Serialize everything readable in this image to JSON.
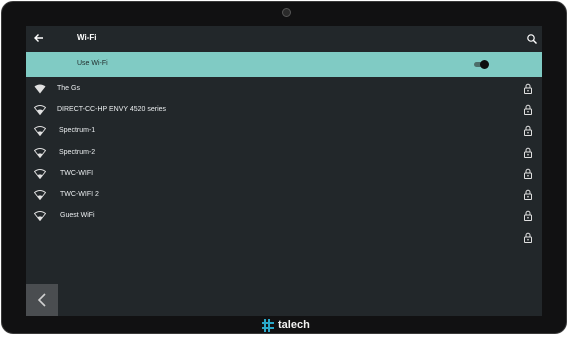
{
  "header": {
    "title": "Wi-Fi"
  },
  "use_wifi": {
    "label": "Use Wi-Fi",
    "enabled": true
  },
  "networks": [
    {
      "name": "The Gs",
      "locked": true
    },
    {
      "name": "DIRECT-CC-HP ENVY 4520 series",
      "locked": true
    },
    {
      "name": "Spectrum-1",
      "locked": true
    },
    {
      "name": "Spectrum-2",
      "locked": true
    },
    {
      "name": "TWC-WIFI",
      "locked": true
    },
    {
      "name": "TWC-WIFI 2",
      "locked": true
    },
    {
      "name": "Guest WiFi",
      "locked": true
    },
    {
      "name": "",
      "locked": true
    }
  ],
  "brand": {
    "name": "talech",
    "accent": "#2aa7c8"
  },
  "colors": {
    "accent_bar": "#80cbc4",
    "screen_bg": "#22272a"
  }
}
